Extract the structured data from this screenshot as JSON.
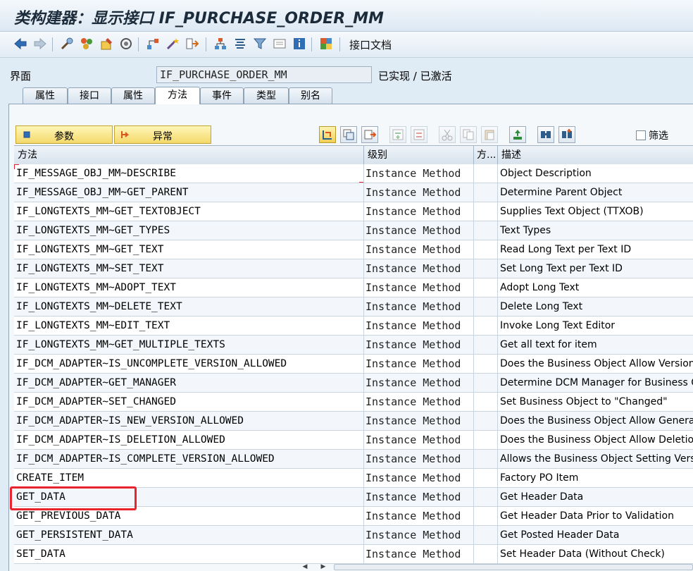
{
  "window": {
    "title": "类构建器：显示接口 IF_PURCHASE_ORDER_MM"
  },
  "toolbar": {
    "icons": [
      "back-icon",
      "forward-icon",
      "tools-icon",
      "objects-icon",
      "change-display-icon",
      "activate-icon",
      "where-used-icon",
      "check-icon",
      "magic-wand-icon",
      "navigate-icon",
      "hierarchy-icon",
      "pretty-printer-icon",
      "filter-icon",
      "document-icon",
      "info-icon",
      "multicolor-icon"
    ],
    "interface_doc_label": "接口文档"
  },
  "header": {
    "interface_label": "界面",
    "interface_value": "IF_PURCHASE_ORDER_MM",
    "status": "已实现 / 已激活"
  },
  "tabs": [
    {
      "label": "属性",
      "active": false
    },
    {
      "label": "接口",
      "active": false
    },
    {
      "label": "属性",
      "active": false
    },
    {
      "label": "方法",
      "active": true
    },
    {
      "label": "事件",
      "active": false
    },
    {
      "label": "类型",
      "active": false
    },
    {
      "label": "别名",
      "active": false
    }
  ],
  "method_toolbar": {
    "params_label": "参数",
    "exceptions_label": "异常",
    "filter_label": "筛选"
  },
  "columns": {
    "method": "方法",
    "level": "级别",
    "m": "方...",
    "description": "描述"
  },
  "rows": [
    {
      "name": "IF_MESSAGE_OBJ_MM~DESCRIBE",
      "level": "Instance Method",
      "desc": "Object Description"
    },
    {
      "name": "IF_MESSAGE_OBJ_MM~GET_PARENT",
      "level": "Instance Method",
      "desc": "Determine Parent Object"
    },
    {
      "name": "IF_LONGTEXTS_MM~GET_TEXTOBJECT",
      "level": "Instance Method",
      "desc": "Supplies Text Object (TTXOB)"
    },
    {
      "name": "IF_LONGTEXTS_MM~GET_TYPES",
      "level": "Instance Method",
      "desc": "Text Types"
    },
    {
      "name": "IF_LONGTEXTS_MM~GET_TEXT",
      "level": "Instance Method",
      "desc": "Read Long Text per Text ID"
    },
    {
      "name": "IF_LONGTEXTS_MM~SET_TEXT",
      "level": "Instance Method",
      "desc": "Set Long Text per Text ID"
    },
    {
      "name": "IF_LONGTEXTS_MM~ADOPT_TEXT",
      "level": "Instance Method",
      "desc": "Adopt Long Text"
    },
    {
      "name": "IF_LONGTEXTS_MM~DELETE_TEXT",
      "level": "Instance Method",
      "desc": "Delete Long Text"
    },
    {
      "name": "IF_LONGTEXTS_MM~EDIT_TEXT",
      "level": "Instance Method",
      "desc": "Invoke Long Text Editor"
    },
    {
      "name": "IF_LONGTEXTS_MM~GET_MULTIPLE_TEXTS",
      "level": "Instance Method",
      "desc": "Get all text for item"
    },
    {
      "name": "IF_DCM_ADAPTER~IS_UNCOMPLETE_VERSION_ALLOWED",
      "level": "Instance Method",
      "desc": "Does the Business Object Allow Version in"
    },
    {
      "name": "IF_DCM_ADAPTER~GET_MANAGER",
      "level": "Instance Method",
      "desc": "Determine DCM Manager for Business Obj"
    },
    {
      "name": "IF_DCM_ADAPTER~SET_CHANGED",
      "level": "Instance Method",
      "desc": "Set Business Object to \"Changed\""
    },
    {
      "name": "IF_DCM_ADAPTER~IS_NEW_VERSION_ALLOWED",
      "level": "Instance Method",
      "desc": "Does the Business Object Allow Generation"
    },
    {
      "name": "IF_DCM_ADAPTER~IS_DELETION_ALLOWED",
      "level": "Instance Method",
      "desc": "Does the Business Object Allow Deletion o"
    },
    {
      "name": "IF_DCM_ADAPTER~IS_COMPLETE_VERSION_ALLOWED",
      "level": "Instance Method",
      "desc": "Allows the Business Object Setting Version"
    },
    {
      "name": "CREATE_ITEM",
      "level": "Instance Method",
      "desc": "Factory PO Item"
    },
    {
      "name": "GET_DATA",
      "level": "Instance Method",
      "desc": "Get Header Data"
    },
    {
      "name": "GET_PREVIOUS_DATA",
      "level": "Instance Method",
      "desc": "Get Header Data Prior to Validation"
    },
    {
      "name": "GET_PERSISTENT_DATA",
      "level": "Instance Method",
      "desc": "Get Posted Header Data"
    },
    {
      "name": "SET_DATA",
      "level": "Instance Method",
      "desc": "Set Header Data (Without Check)"
    }
  ],
  "highlighted_row": "GET_DATA",
  "colors": {
    "highlight": "#e8242e",
    "button_yellow": "#f4d96a",
    "background": "#dfebf5"
  }
}
